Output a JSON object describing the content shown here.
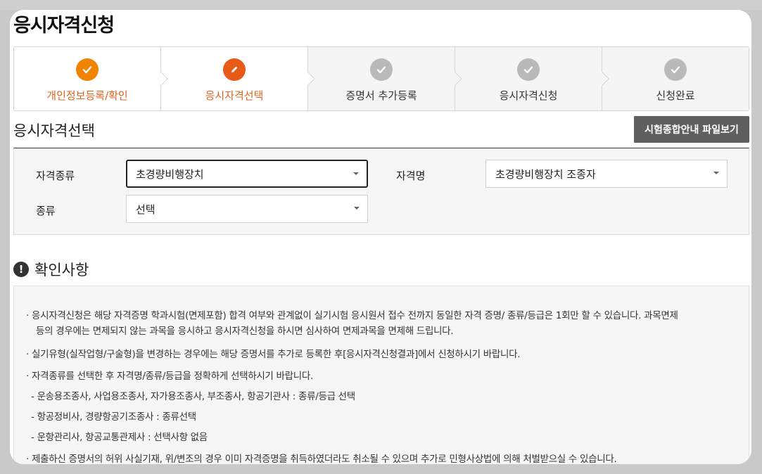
{
  "page_title": "응시자격신청",
  "steps": [
    {
      "label": "개인정보등록/확인",
      "state": "done",
      "icon": "check-icon"
    },
    {
      "label": "응시자격선택",
      "state": "active",
      "icon": "pencil-icon"
    },
    {
      "label": "증명서 추가등록",
      "state": "pending",
      "icon": "check-icon"
    },
    {
      "label": "응시자격신청",
      "state": "pending",
      "icon": "check-icon"
    },
    {
      "label": "신청완료",
      "state": "pending",
      "icon": "check-icon"
    }
  ],
  "section_title": "응시자격선택",
  "guide_button_label": "시험종합안내 파일보기",
  "form": {
    "qual_type_label": "자격종류",
    "qual_type_value": "초경량비행장치",
    "qual_name_label": "자격명",
    "qual_name_value": "초경량비행장치 조종자",
    "kind_label": "종류",
    "kind_value": "선택"
  },
  "notice": {
    "icon_glyph": "!",
    "title": "확인사항",
    "items": [
      "· 응시자격신청은 해당 자격증명 학과시험(면제포함) 합격 여부와 관계없이 실기시험 응시원서 접수 전까지 동일한 자격 증명/ 종류/등급은 1회만 할 수 있습니다. 과목면제",
      "등의 경우에는 면제되지 않는 과목을 응시하고 응시자격신청을 하시면 심사하여 면제과목을 면제해 드립니다.",
      "· 실기유형(실작업형/구술형)을 변경하는 경우에는 해당 증명서를 추가로 등록한 후[응시자격신청결과]에서 신청하시기 바랍니다.",
      "· 자격종류를 선택한 후 자격명/종류/등급을 정확하게 선택하시기 바랍니다.",
      "- 운송용조종사, 사업용조종사, 자가용조종사, 부조종사, 항공기관사 : 종류/등급 선택",
      "- 항공정비사, 경량항공기조종사 : 종류선택",
      "- 운항관리사, 항공교통관제사 : 선택사항 없음",
      "· 제출하신 증명서의 허위 사실기재, 위/변조의 경우 이미 자격증명을 취득하였더라도 취소될 수 있으며 추가로 민형사상법에 의해 처벌받으실 수 있습니다."
    ]
  },
  "colors": {
    "step_done": "#f08300",
    "step_active": "#e85a17",
    "step_pending": "#b9b9b9",
    "accent_text": "#e0651f",
    "button_bg": "#5f5f5f"
  }
}
